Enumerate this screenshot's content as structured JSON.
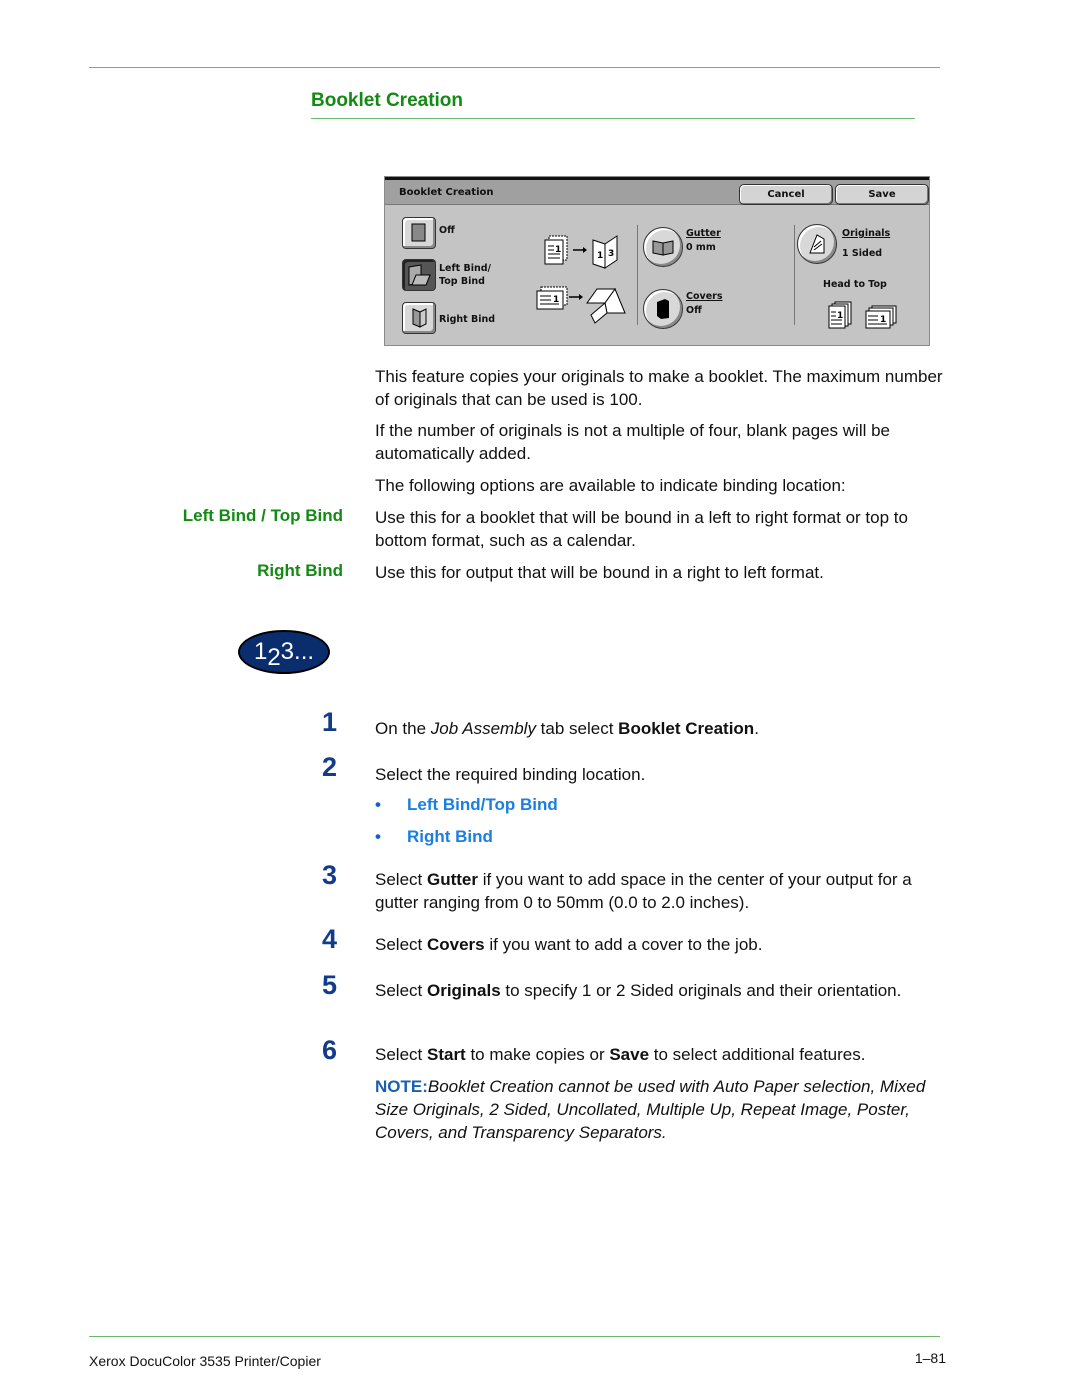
{
  "section_title": "Booklet Creation",
  "ui": {
    "title": "Booklet Creation",
    "cancel_label": "Cancel",
    "save_label": "Save",
    "bind_options": [
      {
        "label": "Off",
        "selected": false
      },
      {
        "label_line1": "Left Bind/",
        "label_line2": "Top Bind",
        "selected": true
      },
      {
        "label": "Right Bind",
        "selected": false
      }
    ],
    "gutter": {
      "label": "Gutter",
      "value": "0 mm"
    },
    "covers": {
      "label": "Covers",
      "value": "Off"
    },
    "originals": {
      "label": "Originals",
      "value": "1 Sided"
    },
    "orientation_label": "Head to Top",
    "page_number_glyph": "1",
    "booklet_glyph_pages": [
      "1",
      "3"
    ]
  },
  "intro": [
    "This feature copies your originals to make a booklet. The maximum number of originals that can be used is 100.",
    "If the number of originals is not a multiple of four, blank pages will be automatically added.",
    "The following options are available to indicate binding location:"
  ],
  "definitions": [
    {
      "term": "Left Bind / Top Bind",
      "text": "Use this for a booklet that will be bound in a left to right format or top to bottom format, such as a calendar."
    },
    {
      "term": "Right Bind",
      "text": "Use this for output that will be bound in a right to left format."
    }
  ],
  "badge": {
    "main": "1",
    "sub": "2",
    "rest": "3..."
  },
  "steps": [
    {
      "num": "1",
      "pre": "On the ",
      "italic": "Job Assembly",
      "mid": " tab select ",
      "bold": "Booklet Creation",
      "post": "."
    },
    {
      "num": "2",
      "text": "Select the required binding location."
    },
    {
      "num": "3",
      "pre": "Select ",
      "bold": "Gutter",
      "post": " if you want to add space in the center of your output for a gutter ranging from 0 to 50mm (0.0 to 2.0 inches)."
    },
    {
      "num": "4",
      "pre": "Select ",
      "bold": "Covers",
      "post": " if you want to add a cover to the job."
    },
    {
      "num": "5",
      "pre": "Select ",
      "bold": "Originals",
      "post": " to specify 1 or 2 Sided originals and their orientation."
    },
    {
      "num": "6",
      "pre": "Select ",
      "bold": "Start",
      "mid": " to make copies or ",
      "bold2": "Save",
      "post": " to select additional features."
    }
  ],
  "bullets": [
    "Left Bind/Top Bind",
    "Right Bind"
  ],
  "bullet_char": "•",
  "note": {
    "label": "NOTE:",
    "text": "Booklet Creation cannot be used with Auto Paper selection, Mixed Size Originals, 2 Sided, Uncollated, Multiple Up, Repeat Image, Poster, Covers, and Transparency Separators."
  },
  "footer": {
    "left": "Xerox DocuColor 3535 Printer/Copier",
    "right": "1–81"
  },
  "colors": {
    "heading_green": "#138a13",
    "rule_green": "#6ab96a",
    "step_blue": "#123c8a",
    "bullet_blue": "#1a7fe0"
  }
}
